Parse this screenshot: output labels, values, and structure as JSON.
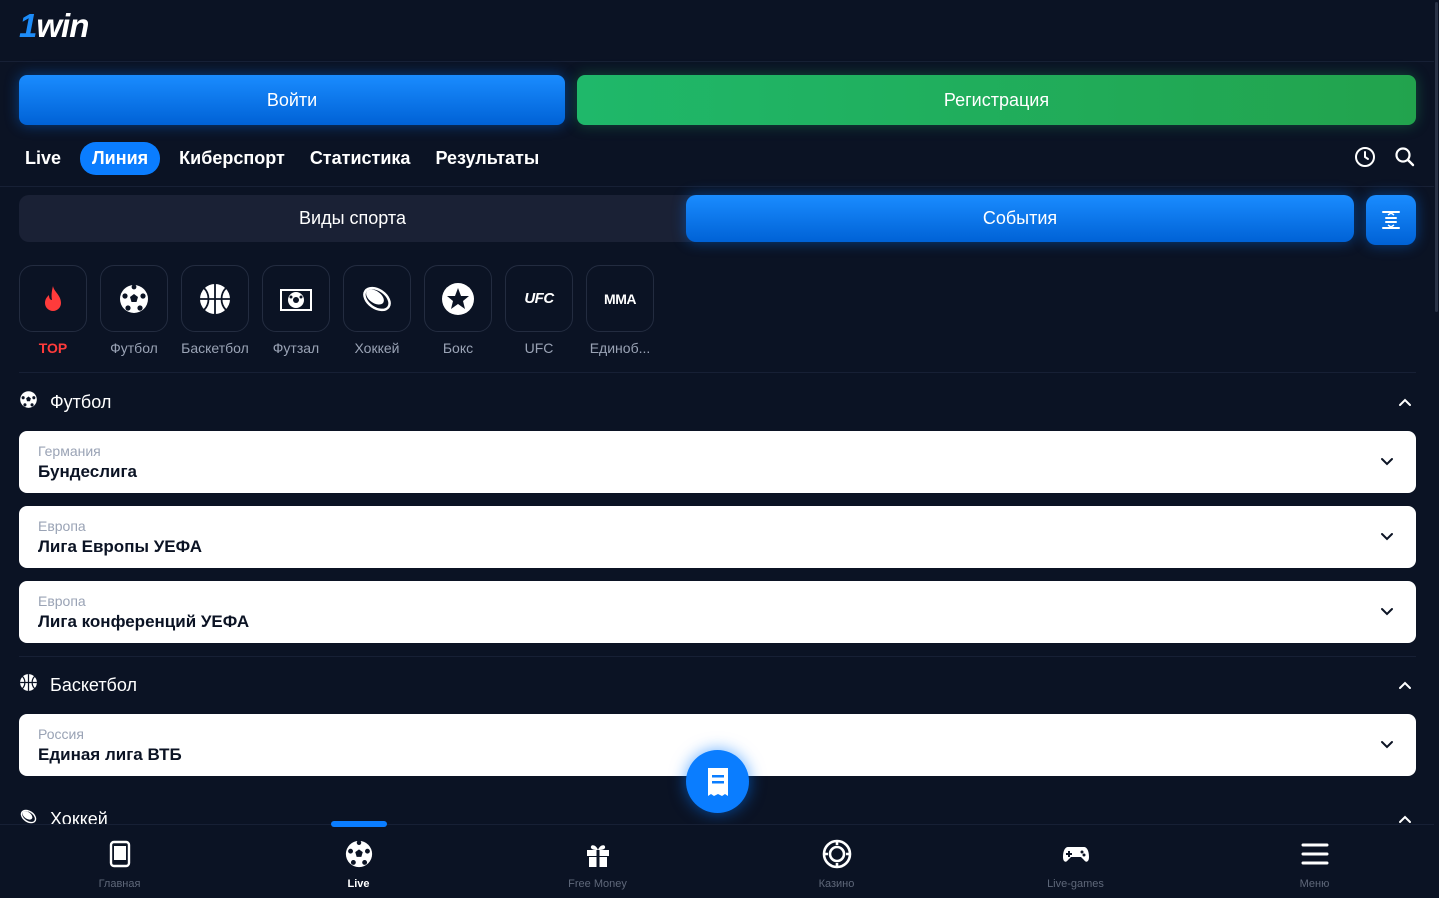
{
  "brand": {
    "logo_one": "1",
    "logo_rest": "win"
  },
  "auth": {
    "login_label": "Войти",
    "register_label": "Регистрация"
  },
  "nav": {
    "tabs": [
      {
        "label": "Live",
        "active": false
      },
      {
        "label": "Линия",
        "active": true
      },
      {
        "label": "Киберспорт",
        "active": false
      },
      {
        "label": "Статистика",
        "active": false
      },
      {
        "label": "Результаты",
        "active": false
      }
    ],
    "icons": [
      "clock-icon",
      "search-icon"
    ]
  },
  "segment": {
    "sports_label": "Виды спорта",
    "events_label": "События",
    "active": "events"
  },
  "sports": [
    {
      "label": "TOP",
      "icon": "fire-icon"
    },
    {
      "label": "Футбол",
      "icon": "soccer-ball-icon"
    },
    {
      "label": "Баскетбол",
      "icon": "basketball-icon"
    },
    {
      "label": "Футзал",
      "icon": "futsal-icon"
    },
    {
      "label": "Хоккей",
      "icon": "hockey-puck-icon"
    },
    {
      "label": "Бокс",
      "icon": "boxing-star-icon"
    },
    {
      "label": "UFC",
      "icon": "ufc-logo",
      "text": "UFC"
    },
    {
      "label": "Единоб...",
      "icon": "mma-logo",
      "text": "MMA"
    }
  ],
  "sections": [
    {
      "title": "Футбол",
      "icon": "soccer-ball-icon",
      "leagues": [
        {
          "country": "Германия",
          "league": "Бундеслига"
        },
        {
          "country": "Европа",
          "league": "Лига Европы УЕФА"
        },
        {
          "country": "Европа",
          "league": "Лига конференций УЕФА"
        }
      ]
    },
    {
      "title": "Баскетбол",
      "icon": "basketball-icon",
      "leagues": [
        {
          "country": "Россия",
          "league": "Единая лига ВТБ"
        }
      ]
    },
    {
      "title": "Хоккей",
      "icon": "hockey-puck-icon",
      "leagues": []
    }
  ],
  "bottom_nav": [
    {
      "label": "Главная",
      "icon": "home-tablet-icon",
      "active": false
    },
    {
      "label": "Live",
      "icon": "soccer-ball-icon",
      "active": true
    },
    {
      "label": "Free Money",
      "icon": "gift-icon",
      "active": false
    },
    {
      "label": "Казино",
      "icon": "casino-chip-icon",
      "active": false
    },
    {
      "label": "Live-games",
      "icon": "gamepad-icon",
      "active": false
    },
    {
      "label": "Меню",
      "icon": "menu-icon",
      "active": false
    }
  ],
  "colors": {
    "accent": "#0a7dff",
    "register": "#22a34d",
    "background": "#0b1324",
    "top": "#ff3b3b"
  }
}
